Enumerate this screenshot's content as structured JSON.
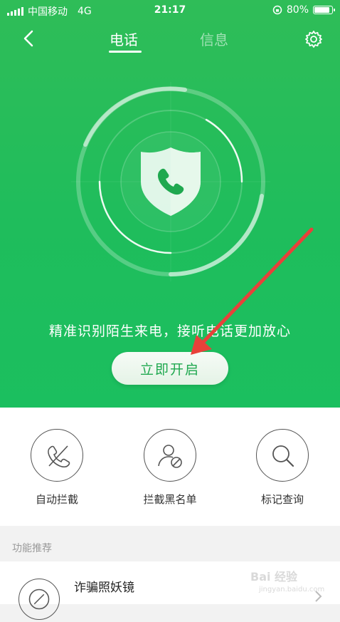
{
  "status_bar": {
    "carrier": "中国移动",
    "network": "4G",
    "time": "21:17",
    "battery": "80%",
    "battery_level": 0.8
  },
  "nav": {
    "tab_call": "电话",
    "tab_message": "信息"
  },
  "hero": {
    "headline": "精准识别陌生来电，接听电话更加放心",
    "open_button": "立即开启"
  },
  "actions": [
    {
      "label": "自动拦截",
      "icon": "phone-blocked-icon"
    },
    {
      "label": "拦截黑名单",
      "icon": "user-blocked-icon"
    },
    {
      "label": "标记查询",
      "icon": "search-icon"
    }
  ],
  "section_title": "功能推荐",
  "feature": {
    "name": "诈骗照妖镜"
  },
  "watermark": {
    "brand": "Bai 经验",
    "url": "jingyan.baidu.com"
  },
  "colors": {
    "primary_green": "#21bd5a",
    "annotation_arrow": "#e8413a"
  }
}
